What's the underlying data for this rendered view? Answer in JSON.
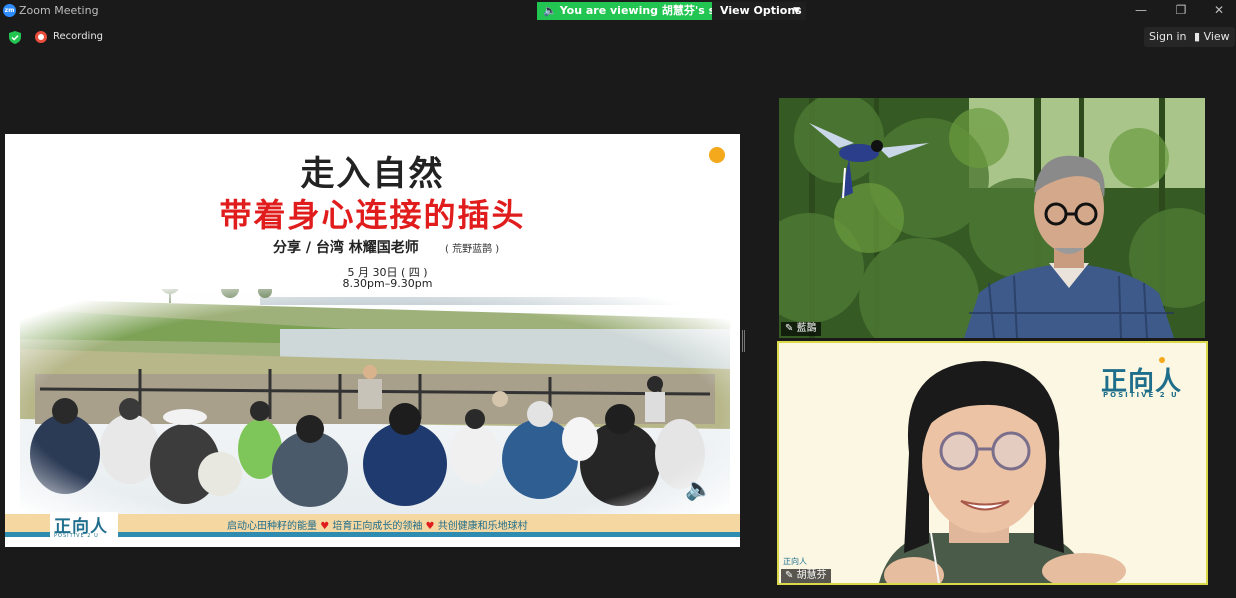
{
  "window": {
    "title": "Zoom Meeting",
    "logo_text": "zm",
    "viewing_banner": "You are viewing 胡慧芬's screen",
    "view_options_label": "View Options",
    "minimize": "—",
    "restore": "❐",
    "close": "✕"
  },
  "toolbar": {
    "recording_label": "Recording",
    "signin_label": "Sign in",
    "view_label": "View"
  },
  "slide": {
    "title_line1": "走入自然",
    "title_line2": "带着身心连接的插头",
    "speaker_line": "分享 / 台湾  林耀国老师",
    "speaker_sub": "( 荒野蓝鹊 )",
    "date_line": "5 月 30日  ( 四 )",
    "time_line": "8.30pm–9.30pm",
    "logo_cn": "正向人",
    "logo_en": "POSITIVE 2 U",
    "footer_part1": "启动心田种籽的能量",
    "footer_part2": "培育正向成长的领袖",
    "footer_part3": "共创健康和乐地球村",
    "heart": "♥"
  },
  "participants": [
    {
      "name": "藍鵲"
    },
    {
      "name": "胡慧芬",
      "bg_logo_cn": "正向人",
      "bg_logo_en": "POSITIVE 2 U",
      "mini_logo": "正向人"
    }
  ],
  "colors": {
    "banner_green": "#23c552",
    "slide_red": "#e01c1c",
    "brand_teal": "#1f6e8c",
    "accent_orange": "#f4a81b",
    "active_speaker_border": "#d9d94a"
  }
}
